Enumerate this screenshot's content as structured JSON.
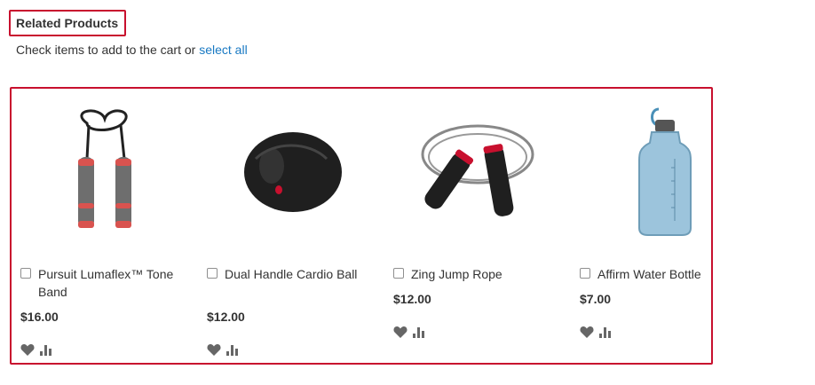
{
  "block": {
    "title": "Related Products",
    "actions_prefix": "Check items to add to the cart or",
    "select_all_label": "select all"
  },
  "products": [
    {
      "name": "Pursuit Lumaflex™ Tone Band",
      "price": "$16.00",
      "image_icon": "tone-band-image"
    },
    {
      "name": "Dual Handle Cardio Ball",
      "price": "$12.00",
      "image_icon": "cardio-ball-image"
    },
    {
      "name": "Zing Jump Rope",
      "price": "$12.00",
      "image_icon": "jump-rope-image"
    },
    {
      "name": "Affirm Water Bottle",
      "price": "$7.00",
      "image_icon": "water-bottle-image"
    }
  ],
  "colors": {
    "highlight_border": "#c8102e",
    "link": "#1979c3",
    "text": "#333333",
    "icon_gray": "#666666"
  }
}
